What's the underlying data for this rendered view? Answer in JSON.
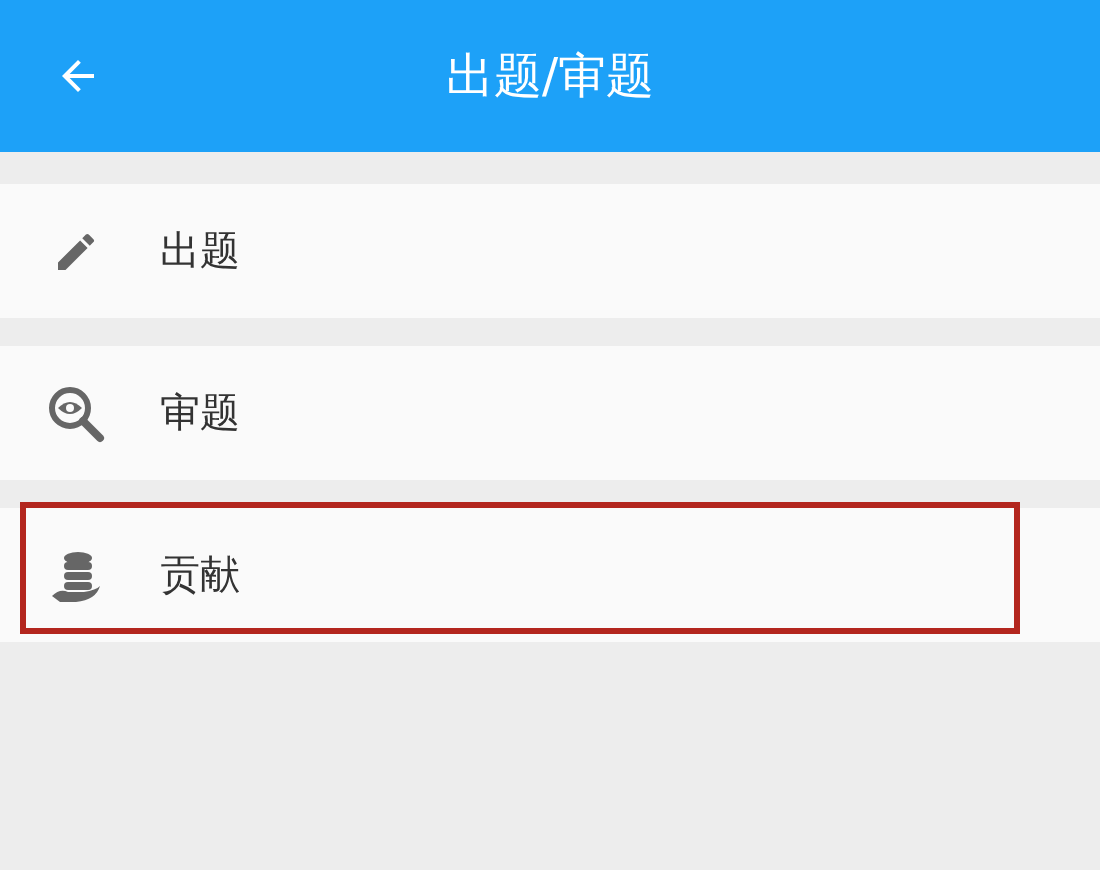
{
  "header": {
    "title": "出题/审题"
  },
  "menu": [
    {
      "label": "出题",
      "highlighted": false
    },
    {
      "label": "审题",
      "highlighted": false
    },
    {
      "label": "贡献",
      "highlighted": true
    }
  ]
}
